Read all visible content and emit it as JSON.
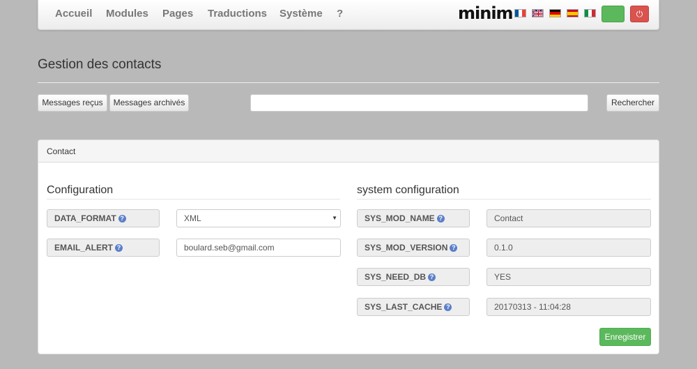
{
  "nav": {
    "items": [
      "Accueil",
      "Modules",
      "Pages",
      "Traductions",
      "Système",
      "?"
    ],
    "logo": "minim",
    "flags": [
      "flag-fr-icon",
      "flag-uk-icon",
      "flag-de-icon",
      "flag-es-icon",
      "flag-it-icon"
    ],
    "power_icon": "⏻"
  },
  "page": {
    "title": "Gestion des contacts"
  },
  "toolbar": {
    "received_label": "Messages reçus",
    "archived_label": "Messages archivés",
    "search_value": "",
    "search_label": "Rechercher"
  },
  "panel": {
    "title": "Contact",
    "config": {
      "title": "Configuration",
      "fields": [
        {
          "label": "DATA_FORMAT",
          "value": "XML"
        },
        {
          "label": "EMAIL_ALERT",
          "value": "boulard.seb@gmail.com"
        }
      ]
    },
    "system": {
      "title": "system configuration",
      "fields": [
        {
          "label": "SYS_MOD_NAME",
          "value": "Contact"
        },
        {
          "label": "SYS_MOD_VERSION",
          "value": "0.1.0"
        },
        {
          "label": "SYS_NEED_DB",
          "value": "YES"
        },
        {
          "label": "SYS_LAST_CACHE",
          "value": "20170313 - 11:04:28"
        }
      ]
    },
    "save_label": "Enregistrer"
  },
  "colors": {
    "accent_green": "#5cb85c",
    "danger_red": "#d9534f",
    "help_blue": "#5b7fc8",
    "background": "#b9b9b9"
  }
}
